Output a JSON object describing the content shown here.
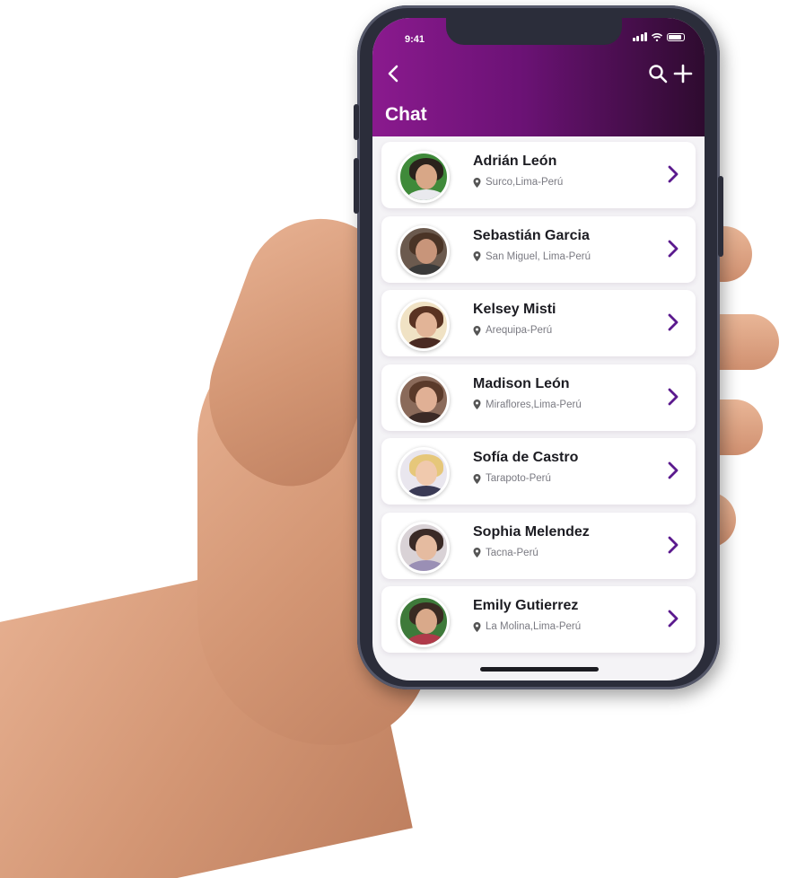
{
  "status_bar": {
    "time": "9:41"
  },
  "header": {
    "title": "Chat",
    "back_icon": "chevron-left-icon",
    "search_icon": "search-icon",
    "add_icon": "plus-icon"
  },
  "colors": {
    "header_gradient_start": "#8a1a8e",
    "header_gradient_end": "#2e0b2f",
    "accent": "#5b1a8e",
    "card_bg": "#ffffff"
  },
  "contacts": [
    {
      "name": "Adrián León",
      "location": "Surco,Lima-Perú"
    },
    {
      "name": "Sebastián Garcia",
      "location": "San Miguel, Lima-Perú"
    },
    {
      "name": "Kelsey Misti",
      "location": "Arequipa-Perú"
    },
    {
      "name": "Madison León",
      "location": "Miraflores,Lima-Perú"
    },
    {
      "name": "Sofía de Castro",
      "location": "Tarapoto-Perú"
    },
    {
      "name": "Sophia Melendez",
      "location": "Tacna-Perú"
    },
    {
      "name": "Emily Gutierrez",
      "location": "La Molina,Lima-Perú"
    }
  ]
}
